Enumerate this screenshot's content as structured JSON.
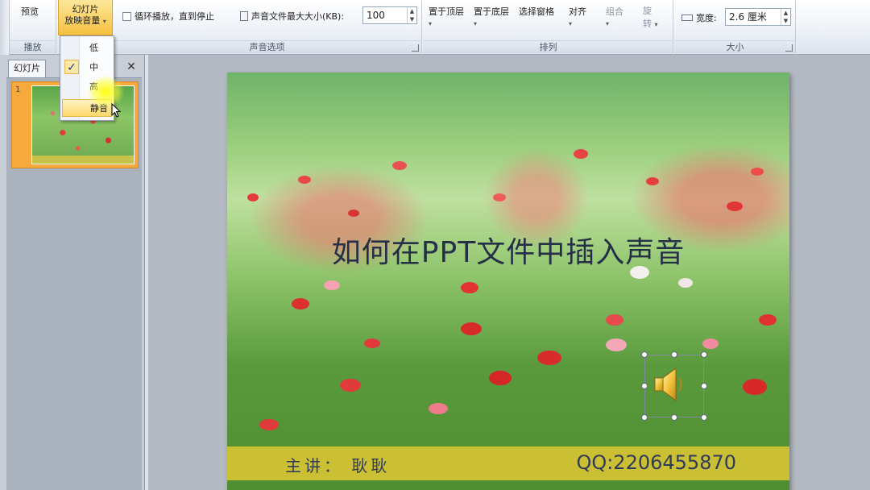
{
  "ribbon": {
    "preview_group": {
      "preview_label": "预览",
      "group_label": "播放"
    },
    "volume_button": {
      "line1": "幻灯片",
      "line2": "放映音量"
    },
    "sound_options": {
      "loop_label": "循环播放，直到停止",
      "max_size_label": "声音文件最大大小(KB):",
      "max_size_value": "100",
      "group_label": "声音选项"
    },
    "arrange": {
      "bring_front": "置于顶层",
      "send_back": "置于底层",
      "selection_pane": "选择窗格",
      "align": "对齐",
      "group": "组合",
      "rotate_line1": "旋",
      "rotate_line2": "转",
      "group_label": "排列"
    },
    "size": {
      "width_label": "宽度:",
      "width_value": "2.6 厘米",
      "group_label": "大小"
    }
  },
  "volume_menu": {
    "items": [
      {
        "label": "低",
        "checked": false
      },
      {
        "label": "中",
        "checked": true
      },
      {
        "label": "高",
        "checked": false
      },
      {
        "label": "静音",
        "checked": false,
        "highlighted": true
      }
    ]
  },
  "slides_pane": {
    "tab_label": "幻灯片",
    "close_glyph": "✕",
    "slide_number": "1"
  },
  "slide": {
    "title": "如何在PPT文件中插入声音",
    "presenter": "主讲： 耿耿",
    "qq": "QQ:2206455870"
  },
  "colors": {
    "accent": "#f6bf3f",
    "footer": "#d6c434",
    "title_text": "#253047"
  }
}
